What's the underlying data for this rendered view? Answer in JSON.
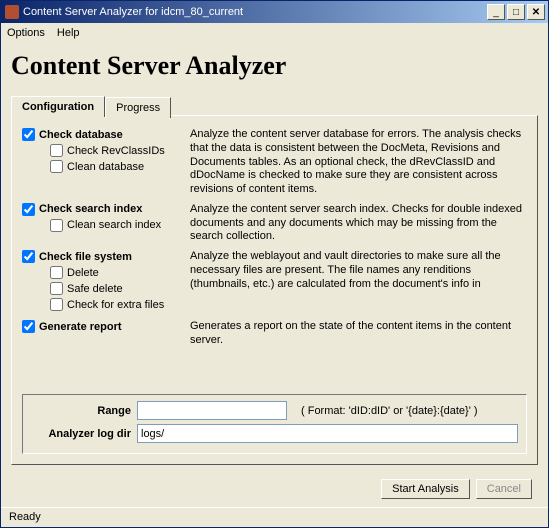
{
  "window": {
    "title": "Content Server Analyzer for idcm_80_current"
  },
  "menu": {
    "options": "Options",
    "help": "Help"
  },
  "heading": "Content Server Analyzer",
  "tabs": {
    "configuration": "Configuration",
    "progress": "Progress"
  },
  "checks": {
    "check_database": {
      "label": "Check database",
      "checked": true,
      "desc": "Analyze the content server database for errors. The analysis checks that the data is consistent between the DocMeta, Revisions and Documents tables. As an optional check, the dRevClassID and dDocName is checked to make sure they are consistent across revisions of content items."
    },
    "check_revclassids": {
      "label": "Check RevClassIDs",
      "checked": false
    },
    "clean_database": {
      "label": "Clean database",
      "checked": false
    },
    "check_search_index": {
      "label": "Check search index",
      "checked": true,
      "desc": "Analyze the content server search index.  Checks for double indexed documents and any documents which may be missing from the search collection."
    },
    "clean_search_index": {
      "label": "Clean search index",
      "checked": false
    },
    "check_file_system": {
      "label": "Check file system",
      "checked": true,
      "desc": "Analyze the weblayout and vault directories to make sure all the necessary files are present. The file names any renditions (thumbnails, etc.) are calculated from the document's info in"
    },
    "delete": {
      "label": "Delete",
      "checked": false
    },
    "safe_delete": {
      "label": "Safe delete",
      "checked": false
    },
    "check_extra_files": {
      "label": "Check for extra files",
      "checked": false
    },
    "generate_report": {
      "label": "Generate report",
      "checked": true,
      "desc": "Generates a report on the state of the content items in the content server."
    }
  },
  "fields": {
    "range_label": "Range",
    "range_value": "",
    "format_hint": "( Format: 'dID:dID' or '{date}:{date}' )",
    "logdir_label": "Analyzer log dir",
    "logdir_value": "logs/"
  },
  "buttons": {
    "start": "Start Analysis",
    "cancel": "Cancel"
  },
  "status": "Ready"
}
